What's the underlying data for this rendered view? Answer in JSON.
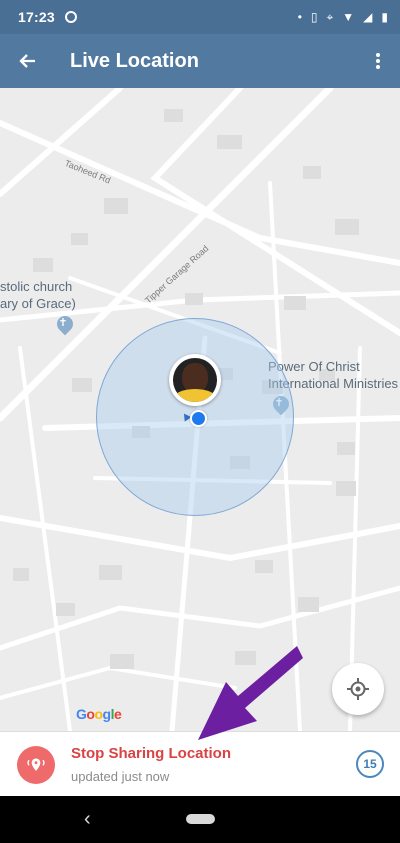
{
  "status_bar": {
    "time": "17:23",
    "icons": [
      "notification-dot-icon",
      "vibrate-icon",
      "location-icon",
      "wifi-icon",
      "signal-icon",
      "battery-icon"
    ]
  },
  "app_bar": {
    "title": "Live Location",
    "back_icon": "arrow-back-icon",
    "menu_icon": "more-vertical-icon"
  },
  "map": {
    "labels": {
      "church_left_line1": "stolic church",
      "church_left_line2": "ary of Grace)",
      "church_right_line1": "Power Of Christ",
      "church_right_line2": "International Ministries",
      "road_taheed": "Taoheed Rd",
      "road_tipper": "Tipper Garage Road"
    },
    "google_logo": "Google",
    "my_location_icon": "my-location-icon"
  },
  "bottom_panel": {
    "action_label": "Stop Sharing Location",
    "status": "updated just now",
    "timer_value": "15",
    "stop_icon": "location-broadcast-icon"
  },
  "colors": {
    "app_bar": "#527aa1",
    "status_bar": "#4a6f94",
    "accent_red": "#d94343",
    "annotation_purple": "#6c1fa0"
  }
}
